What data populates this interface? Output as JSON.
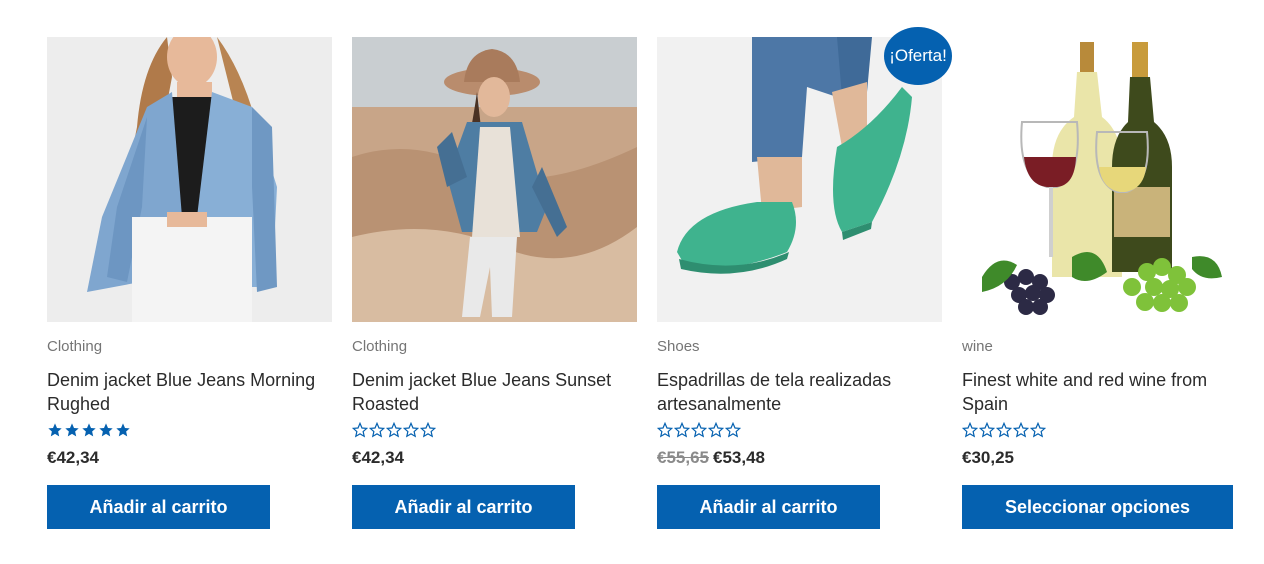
{
  "products": [
    {
      "category": "Clothing",
      "title": "Denim jacket Blue Jeans Morning Rughed",
      "rating": 5,
      "price": "€42,34",
      "old_price": "",
      "button": "Añadir al carrito",
      "image": "woman-denim-jacket-photo"
    },
    {
      "category": "Clothing",
      "title": "Denim jacket Blue Jeans Sunset Roasted",
      "rating": 0,
      "price": "€42,34",
      "old_price": "",
      "button": "Añadir al carrito",
      "image": "woman-hat-field-photo"
    },
    {
      "category": "Shoes",
      "title": "Espadrillas de tela realizadas artesanalmente",
      "rating": 0,
      "price": "€53,48",
      "old_price": "€55,65",
      "badge": "¡Oferta!",
      "button": "Añadir al carrito",
      "image": "green-espadrilles-photo"
    },
    {
      "category": "wine",
      "title": "Finest white and red wine from Spain",
      "rating": 0,
      "price": "€30,25",
      "old_price": "",
      "button": "Seleccionar opciones",
      "image": "wine-bottles-grapes-photo"
    }
  ],
  "colors": {
    "accent": "#0561b0",
    "text": "#2b2b2b",
    "muted": "#757575"
  }
}
